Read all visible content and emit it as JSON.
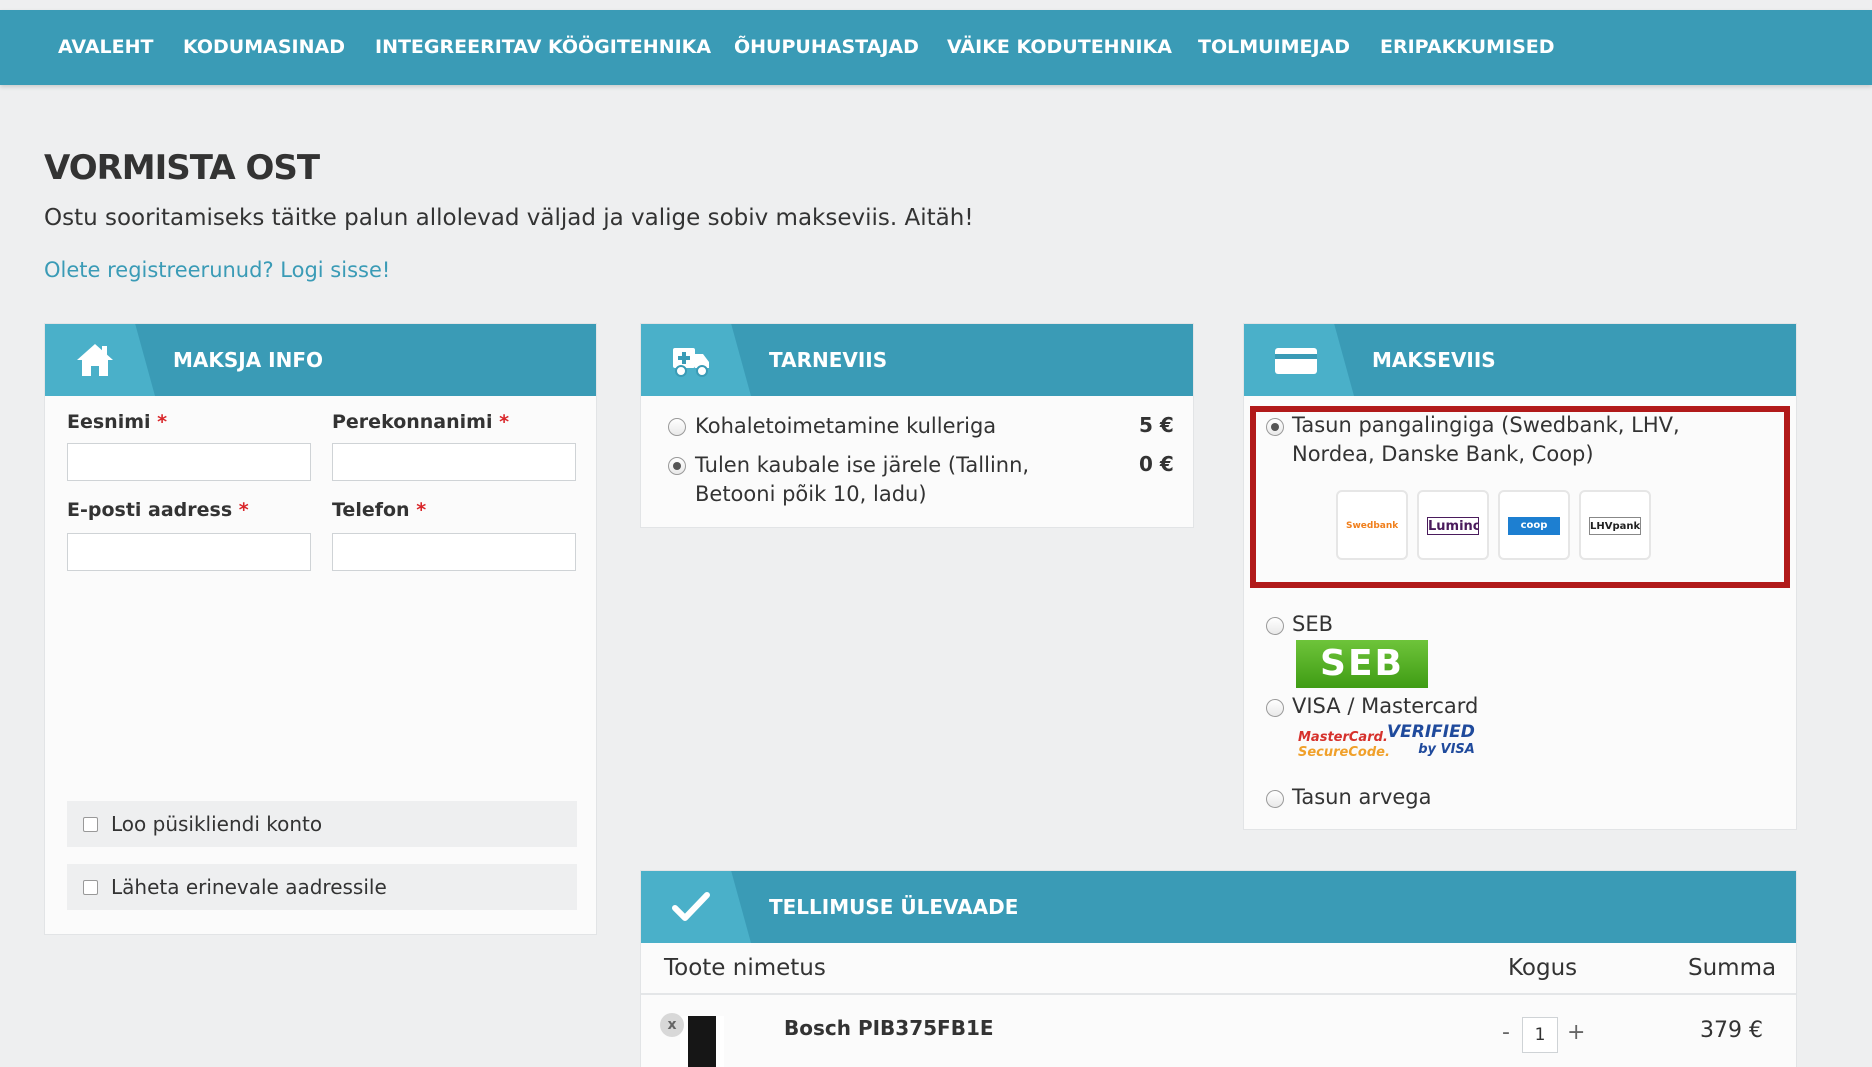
{
  "nav": {
    "items": [
      {
        "label": "AVALEHT"
      },
      {
        "label": "KODUMASINAD"
      },
      {
        "label": "INTEGREERITAV KÖÖGITEHNIKA"
      },
      {
        "label": "ÕHUPUHASTAJAD"
      },
      {
        "label": "VÄIKE KODUTEHNIKA"
      },
      {
        "label": "TOLMUIMEJAD"
      },
      {
        "label": "ERIPAKKUMISED"
      }
    ]
  },
  "page": {
    "title": "VORMISTA OST",
    "subtitle": "Ostu sooritamiseks täitke palun allolevad väljad ja valige sobiv makseviis. Aitäh!",
    "login_link": "Olete registreerunud? Logi sisse!"
  },
  "payer": {
    "title": "MAKSJA INFO",
    "required_mark": "*",
    "fields": {
      "first_name": {
        "label": "Eesnimi",
        "value": ""
      },
      "last_name": {
        "label": "Perekonnanimi",
        "value": ""
      },
      "email": {
        "label": "E-posti aadress",
        "value": ""
      },
      "phone": {
        "label": "Telefon",
        "value": ""
      }
    },
    "create_account": {
      "label": "Loo püsikliendi konto",
      "checked": false
    },
    "different_address": {
      "label": "Läheta erinevale aadressile",
      "checked": false
    }
  },
  "delivery": {
    "title": "TARNEVIIS",
    "options": [
      {
        "label": "Kohaletoimetamine kulleriga",
        "price": "5 €",
        "selected": false
      },
      {
        "label": "Tulen kaubale ise järele (Tallinn, Betooni põik 10, ladu)",
        "price": "0 €",
        "selected": true
      }
    ]
  },
  "payment": {
    "title": "MAKSEVIIS",
    "options": [
      {
        "label": "Tasun pangalingiga (Swedbank, LHV, Nordea, Danske Bank, Coop)",
        "selected": true
      },
      {
        "label": "SEB",
        "selected": false
      },
      {
        "label": "VISA / Mastercard",
        "selected": false
      },
      {
        "label": "Tasun arvega",
        "selected": false
      }
    ],
    "banks": [
      "Swedbank",
      "Luminor",
      "coop",
      "LHVpank"
    ],
    "seb_logo": "SEB",
    "mastercard_logo": {
      "line1": "MasterCard.",
      "line2": "SecureCode."
    },
    "visa_logo": {
      "line1": "VERIFIED",
      "line2": "by VISA"
    }
  },
  "order": {
    "title": "TELLIMUSE ÜLEVAADE",
    "columns": {
      "name": "Toote nimetus",
      "qty": "Kogus",
      "sum": "Summa"
    },
    "items": [
      {
        "remove": "x",
        "name": "Bosch PIB375FB1E",
        "qty": "1",
        "minus": "-",
        "plus": "+",
        "sum": "379 €"
      }
    ]
  },
  "colors": {
    "accent": "#3a9bb6",
    "accent_light": "#4ab0c9",
    "highlight_frame": "#b11a1a",
    "required": "#d9262a",
    "link": "#3a9bb6"
  }
}
